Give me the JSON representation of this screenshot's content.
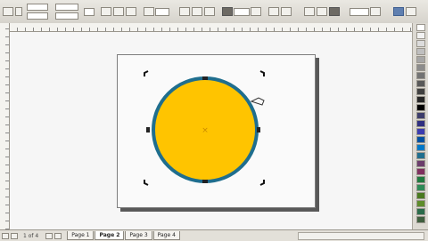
{
  "toolbar": {
    "icons": [
      "object-origin-icon",
      "position-fields-icon",
      "size-fields-icon",
      "scale-icon",
      "lock-ratio-icon",
      "rotate-icon",
      "mirror-icon",
      "ellipse-mode-icon",
      "pie-mode-icon",
      "arc-mode-icon",
      "angle-icon",
      "wrap-icon",
      "outline-width-icon",
      "front-icon",
      "back-icon",
      "convert-icon"
    ]
  },
  "pager": {
    "count": "1 of 4",
    "tabs": [
      "Page 1",
      "Page 2",
      "Page 3",
      "Page 4"
    ],
    "active_index": 1
  },
  "colors": {
    "circle_fill": "#ffc400",
    "circle_outline": "#1f6e8e",
    "page_shadow": "#595959",
    "palette": [
      "#ffffff",
      "#f2f2f2",
      "#dcdcdc",
      "#bfbfbf",
      "#a6a6a6",
      "#8c8c8c",
      "#737373",
      "#595959",
      "#404040",
      "#262626",
      "#000000",
      "#3d3d6b",
      "#2f2f80",
      "#3b3bb0",
      "#0050a0",
      "#0078c8",
      "#1f6e8e",
      "#6b3d6b",
      "#802f5f",
      "#1f7a3f",
      "#2e8b57",
      "#4a7a1f",
      "#5e8c2a",
      "#2a6b4a",
      "#3f5f3f"
    ]
  }
}
